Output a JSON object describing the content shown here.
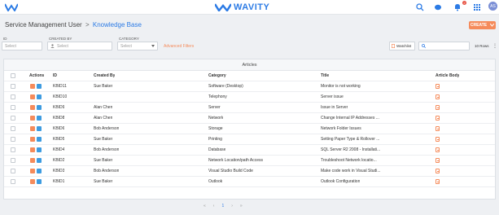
{
  "header": {
    "brand": "WAVITY",
    "avatar_initials": "AS",
    "notification_count": "2"
  },
  "breadcrumb": {
    "parent": "Service Management User",
    "separator": ">",
    "current": "Knowledge Base"
  },
  "create_button": "CREATE",
  "filters": {
    "id_label": "ID",
    "id_placeholder": "Select",
    "created_by_label": "CREATED BY",
    "created_by_placeholder": "Select",
    "category_label": "CATEGORY",
    "category_placeholder": "Select",
    "advanced": "Advanced Filters"
  },
  "toolbar": {
    "watchlist": "Watchlist",
    "rows": "10 Rows"
  },
  "table": {
    "title": "Articles",
    "headers": [
      "Actions",
      "ID",
      "Created By",
      "Category",
      "Title",
      "Article Body"
    ],
    "rows": [
      {
        "id": "KBID11",
        "created_by": "Sue Baker",
        "category": "Software (Desktop)",
        "title": "Monitor is not working"
      },
      {
        "id": "KBID10",
        "created_by": "",
        "category": "Telephony",
        "title": "Server issue"
      },
      {
        "id": "KBID9",
        "created_by": "Alan Chen",
        "category": "Server",
        "title": "Issue in Server"
      },
      {
        "id": "KBID8",
        "created_by": "Alan Chen",
        "category": "Network",
        "title": "Change Internal IP Addresses ..."
      },
      {
        "id": "KBID6",
        "created_by": "Bob Anderson",
        "category": "Storage",
        "title": "Network Folder Issues"
      },
      {
        "id": "KBID5",
        "created_by": "Sue Baker",
        "category": "Printing",
        "title": "Setting Paper Type & Rollover ..."
      },
      {
        "id": "KBID4",
        "created_by": "Bob Anderson",
        "category": "Database",
        "title": "SQL Server R2 2008 - Installati..."
      },
      {
        "id": "KBID2",
        "created_by": "Sue Baker",
        "category": "Network Location/path Access",
        "title": "Troubleshoot Network locatio..."
      },
      {
        "id": "KBID3",
        "created_by": "Bob Anderson",
        "category": "Visual Studio Build Code",
        "title": "Make code work in Visual Studi..."
      },
      {
        "id": "KBID1",
        "created_by": "Sue Baker",
        "category": "Outlook",
        "title": "Outlook Configuration"
      }
    ]
  },
  "pagination": {
    "first": "«",
    "prev": "‹",
    "current": "1",
    "next": "›",
    "last": "»"
  },
  "colors": {
    "accent": "#2c7be5",
    "orange": "#f58b5b",
    "blue_action": "#3d9be0"
  }
}
